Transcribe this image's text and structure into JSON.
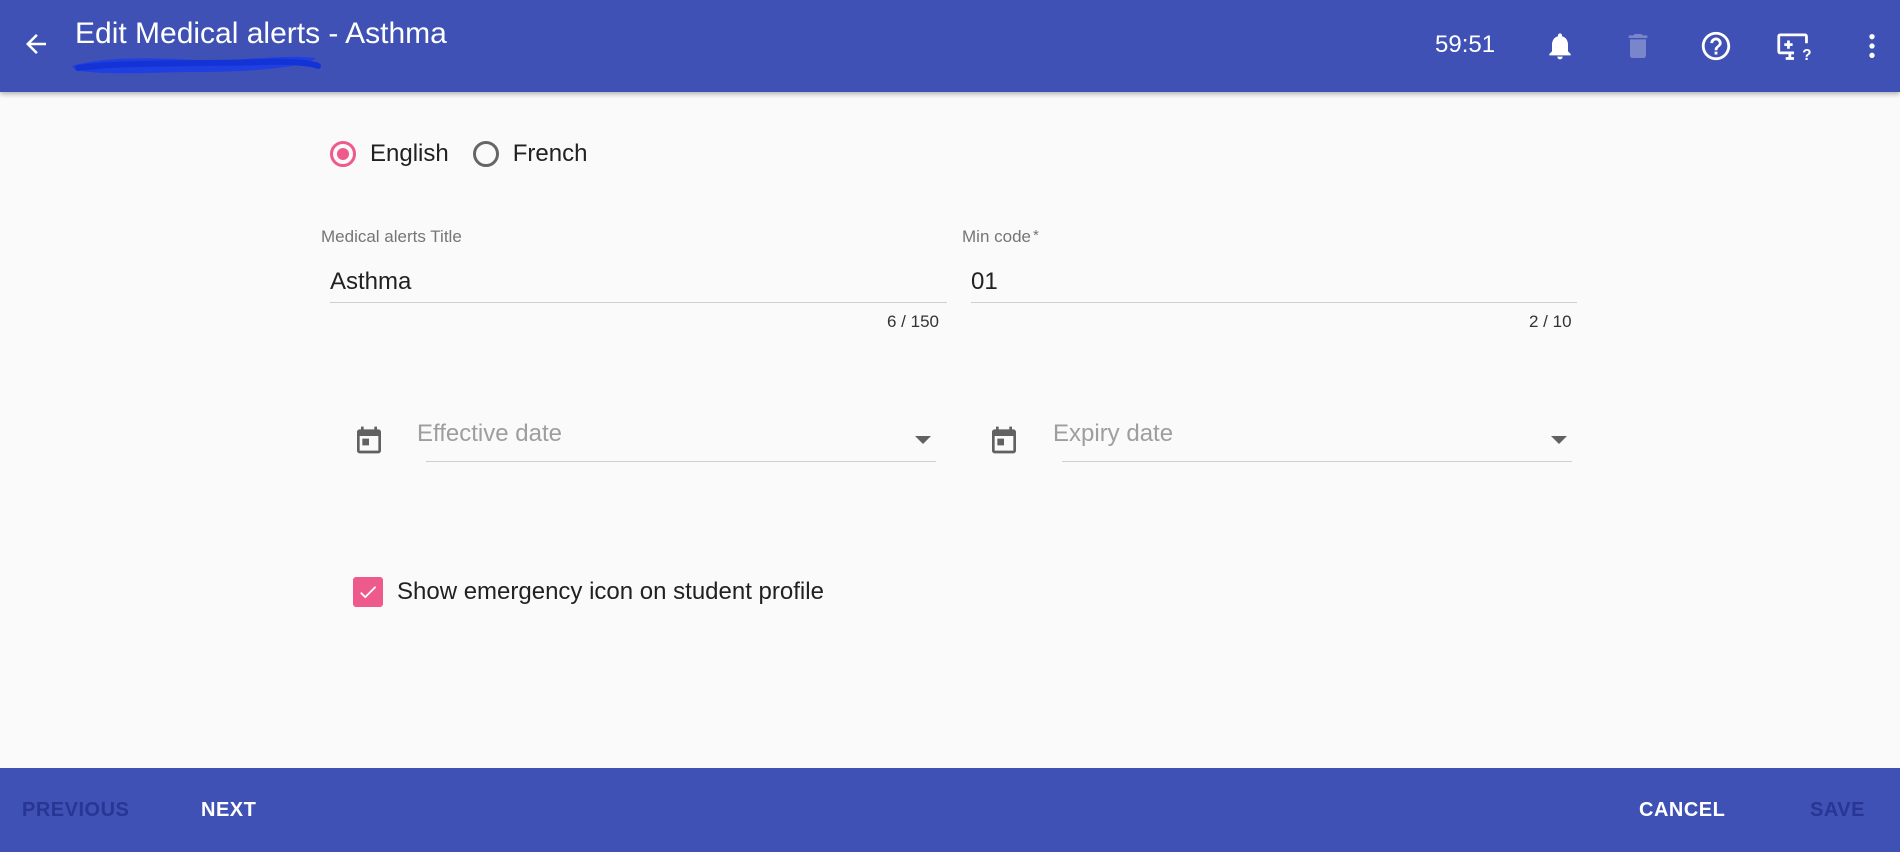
{
  "header": {
    "title": "Edit Medical alerts - Asthma",
    "timer": "59:51",
    "icons": {
      "back": "arrow-left-icon",
      "notifications": "bell-icon",
      "delete": "trash-icon",
      "help": "help-circle-icon",
      "screen_help": "monitor-help-icon",
      "menu": "more-vertical-icon"
    },
    "background_color": "#3f51b5"
  },
  "language": {
    "options": [
      {
        "label": "English",
        "selected": true
      },
      {
        "label": "French",
        "selected": false
      }
    ],
    "accent_color": "#ef5a8c"
  },
  "form": {
    "title_field": {
      "label": "Medical alerts Title",
      "value": "Asthma",
      "counter": "6 / 150"
    },
    "min_code_field": {
      "label": "Min code",
      "required_mark": "*",
      "value": "01",
      "counter": "2 / 10"
    },
    "effective_date": {
      "placeholder": "Effective date",
      "icon": "calendar-icon"
    },
    "expiry_date": {
      "placeholder": "Expiry date",
      "icon": "calendar-icon"
    },
    "emergency_checkbox": {
      "label": "Show emergency icon on student profile",
      "checked": true
    }
  },
  "footer": {
    "previous": "PREVIOUS",
    "next": "NEXT",
    "cancel": "CANCEL",
    "save": "SAVE"
  }
}
